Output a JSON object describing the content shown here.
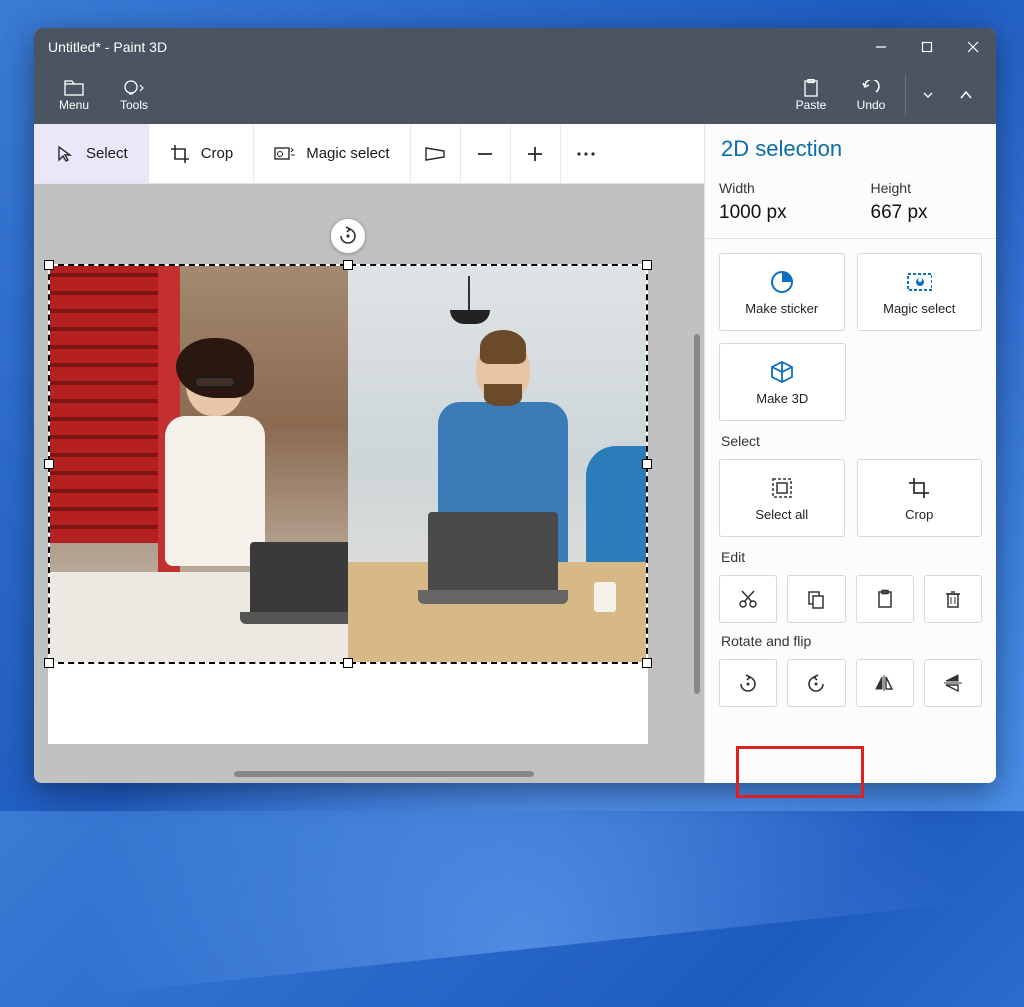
{
  "window": {
    "title": "Untitled* - Paint 3D"
  },
  "menubar": {
    "menu": "Menu",
    "tools": "Tools",
    "paste": "Paste",
    "undo": "Undo"
  },
  "canvas_toolbar": {
    "select": "Select",
    "crop": "Crop",
    "magic_select": "Magic select"
  },
  "panel": {
    "title": "2D selection",
    "width_label": "Width",
    "width_value": "1000 px",
    "height_label": "Height",
    "height_value": "667 px",
    "make_sticker": "Make sticker",
    "magic_select": "Magic select",
    "make_3d": "Make 3D",
    "select_section": "Select",
    "select_all": "Select all",
    "crop": "Crop",
    "edit_section": "Edit",
    "rotate_section": "Rotate and flip"
  }
}
